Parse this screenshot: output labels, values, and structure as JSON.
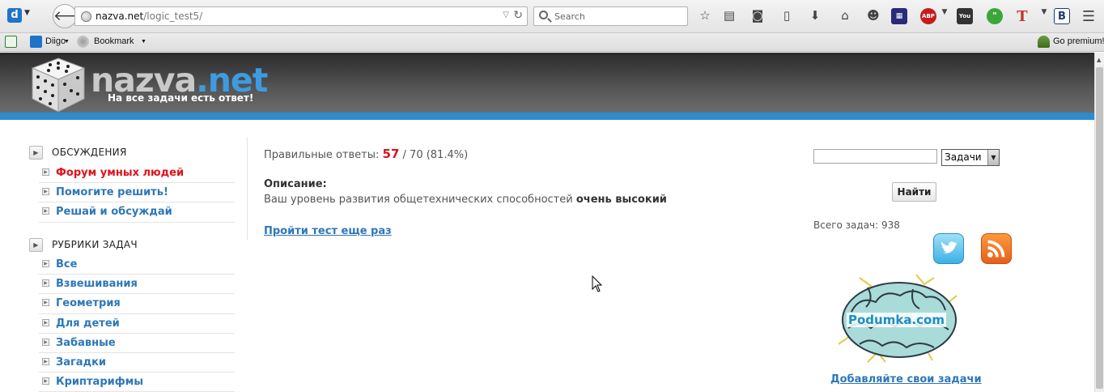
{
  "browser": {
    "url_domain": "nazva.net",
    "url_path": "/logic_test5/",
    "search_placeholder": "Search",
    "bookmarks": {
      "diigo_label": "Diigo",
      "bookmark_label": "Bookmark",
      "premium_label": "Go premium!"
    }
  },
  "site": {
    "logo_main": "nazva",
    "logo_dot_net": ".net",
    "tagline": "На все задачи есть ответ!"
  },
  "sidebar": {
    "discussions_title": "ОБСУЖДЕНИЯ",
    "discussions": [
      {
        "label": "Форум умных людей"
      },
      {
        "label": "Помогите решить!"
      },
      {
        "label": "Решай и обсуждай"
      }
    ],
    "rubrics_title": "РУБРИКИ ЗАДАЧ",
    "rubrics": [
      {
        "label": "Все"
      },
      {
        "label": "Взвешивания"
      },
      {
        "label": "Геометрия"
      },
      {
        "label": "Для детей"
      },
      {
        "label": "Забавные"
      },
      {
        "label": "Загадки"
      },
      {
        "label": "Криптарифмы"
      }
    ]
  },
  "main": {
    "correct_label": "Правильные ответы:",
    "correct_count": "57",
    "total_count": "/ 70 (81.4%)",
    "description_title": "Описание:",
    "description_text": "Ваш уровень развития общетехнических способностей",
    "description_level": "очень высокий",
    "retake_link": "Пройти тест еще раз"
  },
  "right": {
    "search_value": "",
    "select_value": "Задачи",
    "find_button": "Найти",
    "total_tasks": "Всего задач: 938",
    "podumka_label": "Podumka.com",
    "add_tasks_link": "Добавляйте свои задачи"
  }
}
